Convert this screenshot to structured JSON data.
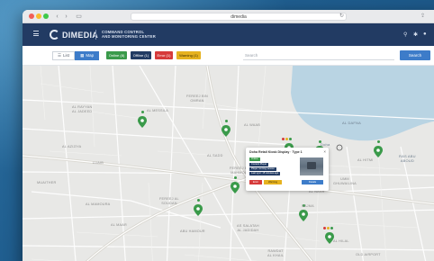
{
  "browser": {
    "url": "dimedia",
    "back_icon": "chevron-left-icon",
    "forward_icon": "chevron-right-icon"
  },
  "header": {
    "logo_text": "DIMEDIA",
    "title_line1": "COMMAND CONTROL",
    "title_line2": "AND MONITORING CENTER"
  },
  "toolbar": {
    "list_label": "List",
    "map_label": "Map",
    "statuses": [
      {
        "label": "Online (8)",
        "color": "#3a9a4a"
      },
      {
        "label": "Offline (1)",
        "color": "#223b63"
      },
      {
        "label": "Error (1)",
        "color": "#d63a3a"
      },
      {
        "label": "Warning (1)",
        "color": "#e6b21f"
      }
    ],
    "search_placeholder": "Search",
    "search_button": "Search"
  },
  "map": {
    "areas": [
      {
        "id": "al-rayyan",
        "text": "AL RAYYAN\nAL JADEED"
      },
      {
        "id": "al-messila",
        "text": "AL MESSILA"
      },
      {
        "id": "fereej-bin-omran",
        "text": "FEREEJ BIN\nOMRAN"
      },
      {
        "id": "al-waab",
        "text": "AL WAAB"
      },
      {
        "id": "al-sadd",
        "text": "AL SADD"
      },
      {
        "id": "al-aziziya",
        "text": "AL AZIZIYA"
      },
      {
        "id": "luaib",
        "text": "LUAIB"
      },
      {
        "id": "fereej-bin-mahmoud",
        "text": "FEREEJ BIN\nMAHMOUD"
      },
      {
        "id": "al-muntazah",
        "text": "AL MUNTAZAH"
      },
      {
        "id": "umm-ghuwailina",
        "text": "UMM\nGHUWAILINA"
      },
      {
        "id": "al-hilal",
        "text": "AL HILAL"
      },
      {
        "id": "muaither",
        "text": "MUAITHER"
      },
      {
        "id": "fereej-al-soudan",
        "text": "FEREEJ AL\nSOUDAN"
      },
      {
        "id": "al-mamoura",
        "text": "AL MAMOURA"
      },
      {
        "id": "al-maar",
        "text": "AL MAAR"
      },
      {
        "id": "abu-hamour",
        "text": "ABU HAMOUR"
      },
      {
        "id": "as-salatah",
        "text": "AS SALATAH\nAL JADIDAH"
      },
      {
        "id": "najma",
        "text": "NAJMA"
      },
      {
        "id": "ras-abu-aboud",
        "text": "RAS ABU\nABOUD"
      },
      {
        "id": "corniche",
        "text": "Doha"
      },
      {
        "id": "musheireb",
        "text": "Msheireb"
      },
      {
        "id": "old-airport",
        "text": "OLD AIRPORT"
      },
      {
        "id": "rawdat-al-khail",
        "text": "RAWDAT\nAL KHAIL"
      },
      {
        "id": "al-nasr",
        "text": "AL NASR"
      },
      {
        "id": "al-hitmi",
        "text": "AL HITMI"
      },
      {
        "id": "al-dafna",
        "text": "AL DAFNA"
      }
    ],
    "pins": [
      {
        "id": "pin-1",
        "status": "online",
        "color": "#3a9a4a"
      },
      {
        "id": "pin-2",
        "status": "online",
        "color": "#3a9a4a"
      },
      {
        "id": "pin-3",
        "status": "online",
        "color": "#3a9a4a"
      },
      {
        "id": "pin-4",
        "status": "online",
        "color": "#3a9a4a"
      },
      {
        "id": "pin-5",
        "status": "online",
        "color": "#3a9a4a"
      },
      {
        "id": "pin-6",
        "status": "online",
        "color": "#3a9a4a"
      },
      {
        "id": "pin-7",
        "status": "online",
        "color": "#3a9a4a"
      },
      {
        "id": "pin-8",
        "status": "online",
        "color": "#3a9a4a"
      },
      {
        "id": "pin-9",
        "status": "online",
        "color": "#3a9a4a"
      },
      {
        "id": "pin-10",
        "status": "multi",
        "color": "#3a9a4a"
      }
    ],
    "popup": {
      "title": "Doha Retail Kiosk Display · Type 1",
      "tag_online": "Online",
      "tag_line2": "Content Player",
      "tag_line3": "Player running version",
      "tag_line4": "Last sync: 15 minutes ago",
      "btn_error": "Error",
      "btn_warning": "Warning",
      "btn_details": "Details",
      "close_icon": "close-icon",
      "thumb_alt": "Device thumbnail"
    }
  }
}
